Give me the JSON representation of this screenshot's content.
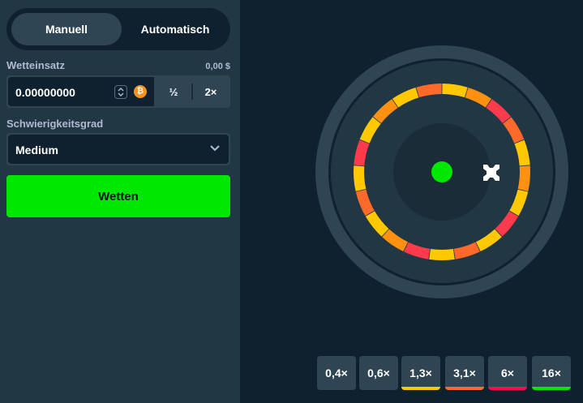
{
  "mode_tabs": {
    "manual": "Manuell",
    "auto": "Automatisch"
  },
  "bet": {
    "label": "Wetteinsatz",
    "fiat_value": "0,00 $",
    "value": "0.00000000",
    "half_label": "½",
    "double_label": "2×",
    "currency_icon": "bitcoin-icon"
  },
  "difficulty": {
    "label": "Schwierigkeitsgrad",
    "value": "Medium"
  },
  "action": {
    "bet_label": "Wetten"
  },
  "wheel": {
    "segment_colors": [
      "#ffc800",
      "#ff9010",
      "#ff3a4c",
      "#ff6a2b",
      "#ffc800",
      "#ff9010",
      "#ffc800",
      "#ff3a4c",
      "#ffc800",
      "#ff6a2b",
      "#ffc800",
      "#ff3a4c",
      "#ff9010",
      "#ffc800",
      "#ff6a2b",
      "#ffc800",
      "#ff3a4c",
      "#ffc800",
      "#ff9010",
      "#ffc800",
      "#ff6a2b"
    ],
    "pointer_color": "#00e701"
  },
  "multipliers": [
    {
      "label": "0,4×",
      "color": ""
    },
    {
      "label": "0,6×",
      "color": ""
    },
    {
      "label": "1,3×",
      "color": "#ffc800"
    },
    {
      "label": "3,1×",
      "color": "#ff6a2b"
    },
    {
      "label": "6×",
      "color": "#ff0a4c"
    },
    {
      "label": "16×",
      "color": "#00e701"
    }
  ]
}
